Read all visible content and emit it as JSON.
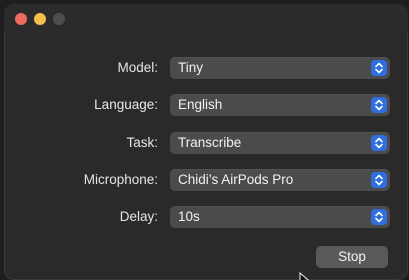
{
  "window": {
    "traffic_lights": [
      "close",
      "minimize",
      "maximize"
    ]
  },
  "form": {
    "rows": [
      {
        "label": "Model:",
        "value": "Tiny"
      },
      {
        "label": "Language:",
        "value": "English"
      },
      {
        "label": "Task:",
        "value": "Transcribe"
      },
      {
        "label": "Microphone:",
        "value": "Chidi’s AirPods Pro"
      },
      {
        "label": "Delay:",
        "value": "10s"
      }
    ]
  },
  "actions": {
    "stop_label": "Stop"
  },
  "colors": {
    "accent": "#2f6fe0",
    "close": "#ed6a5e",
    "minimize": "#f5bf4f",
    "maximize_inactive": "#4e4e4e"
  },
  "icons": {
    "select_indicator": "up-down-chevron-icon",
    "pointer": "mouse-cursor-icon"
  }
}
